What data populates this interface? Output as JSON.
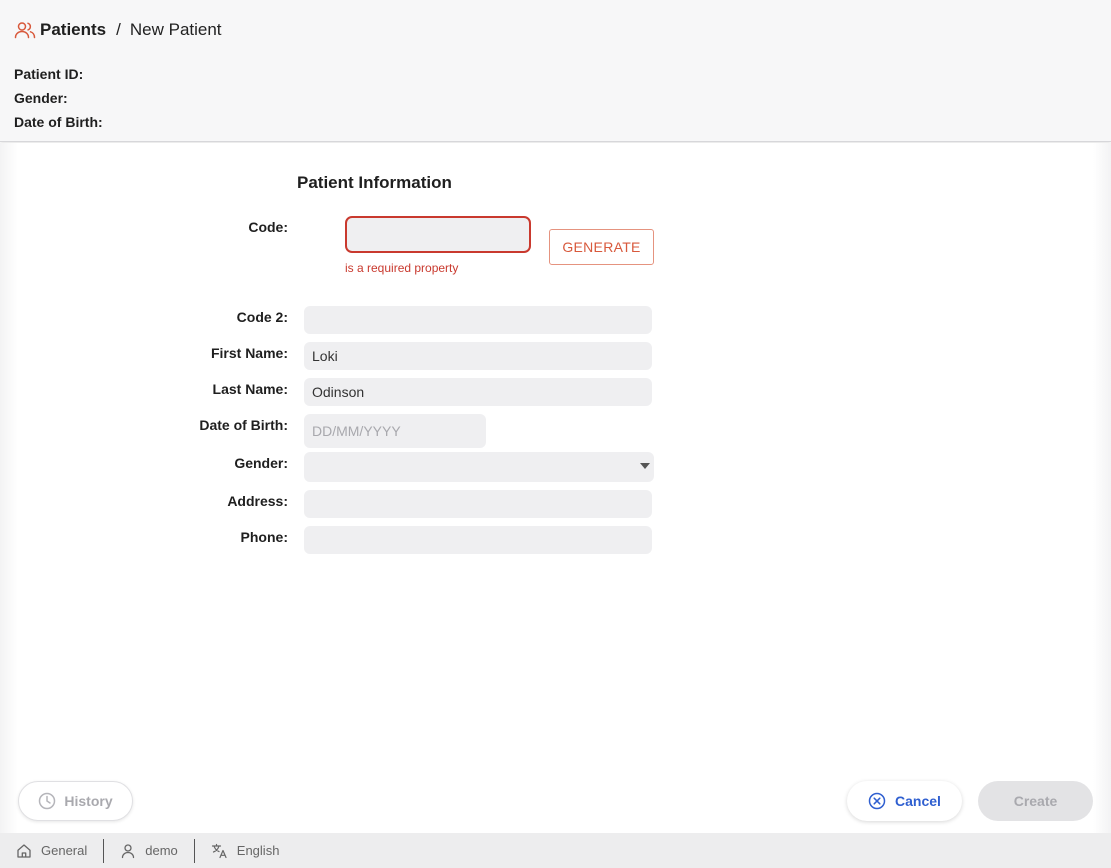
{
  "breadcrumb": {
    "root": "Patients",
    "separator": "/",
    "current": "New Patient",
    "icon": "users-icon"
  },
  "patient_meta": {
    "patient_id_label": "Patient ID:",
    "gender_label": "Gender:",
    "dob_label": "Date of Birth:"
  },
  "form": {
    "title": "Patient Information",
    "code": {
      "label": "Code:",
      "value": "",
      "error": "is a required property"
    },
    "generate_label": "GENERATE",
    "code2": {
      "label": "Code 2:",
      "value": ""
    },
    "first_name": {
      "label": "First Name:",
      "value": "Loki"
    },
    "last_name": {
      "label": "Last Name:",
      "value": "Odinson"
    },
    "dob": {
      "label": "Date of Birth:",
      "placeholder": "DD/MM/YYYY"
    },
    "gender": {
      "label": "Gender:",
      "value": ""
    },
    "address": {
      "label": "Address:",
      "value": ""
    },
    "phone": {
      "label": "Phone:",
      "value": ""
    }
  },
  "actions": {
    "history_label": "History",
    "cancel_label": "Cancel",
    "create_label": "Create"
  },
  "statusbar": {
    "workspace": "General",
    "user": "demo",
    "language": "English"
  },
  "colors": {
    "accent": "#d8593c",
    "error": "#c9392e",
    "link": "#2f5fd0"
  }
}
